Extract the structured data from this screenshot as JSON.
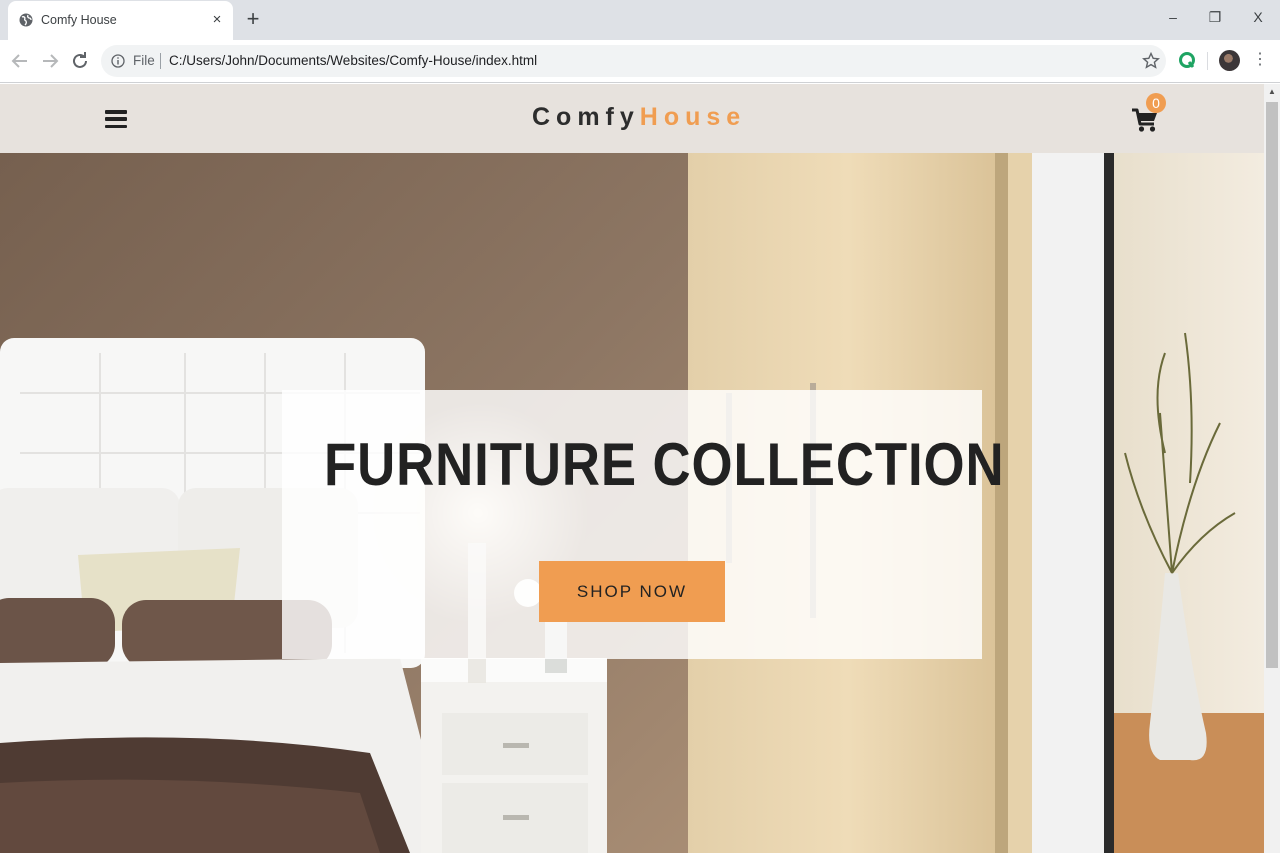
{
  "browser": {
    "tab": {
      "title": "Comfy House",
      "close": "×"
    },
    "new_tab": "+",
    "window_controls": {
      "minimize": "–",
      "restore": "❐",
      "close": "X"
    },
    "omnibox": {
      "scheme": "File",
      "url": "C:/Users/John/Documents/Websites/Comfy-House/index.html"
    },
    "menu": "⋮",
    "icons": [
      "globe-icon",
      "back-icon",
      "forward-icon",
      "reload-icon",
      "info-icon",
      "star-icon",
      "extension-icon",
      "avatar",
      "menu-icon"
    ],
    "accent": "#1fa463"
  },
  "site": {
    "logo": {
      "part1": "Comfy",
      "part2": "House"
    },
    "cart_count": "0",
    "hero": {
      "title": "FURNITURE COLLECTION",
      "cta": "SHOP NOW"
    },
    "colors": {
      "primary": "#f09d51",
      "nav_bg": "#e7e2dd",
      "text": "#222222"
    }
  }
}
